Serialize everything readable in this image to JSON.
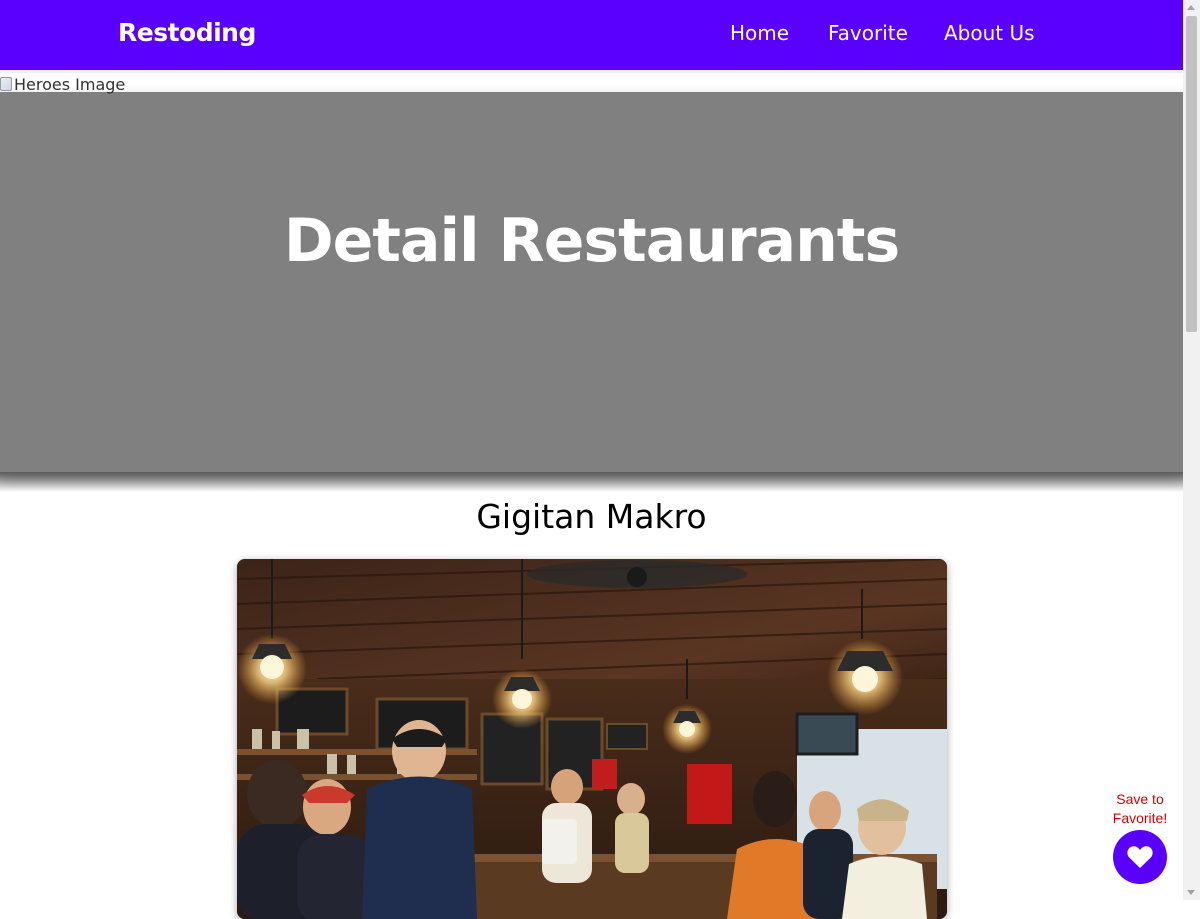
{
  "header": {
    "brand": "Restoding",
    "nav": [
      {
        "label": "Home"
      },
      {
        "label": "Favorite"
      },
      {
        "label": "About Us"
      }
    ],
    "background_color": "#5a00ff"
  },
  "hero": {
    "image_alt": "Heroes Image",
    "title": "Detail Restaurants",
    "background_color": "#808080"
  },
  "restaurant": {
    "name": "Gigitan Makro",
    "photo_icon": "restaurant-interior-photo"
  },
  "favorite": {
    "label": "Save to Favorite!",
    "icon": "heart-icon",
    "button_color": "#5a00ff",
    "label_color": "#d40000"
  }
}
